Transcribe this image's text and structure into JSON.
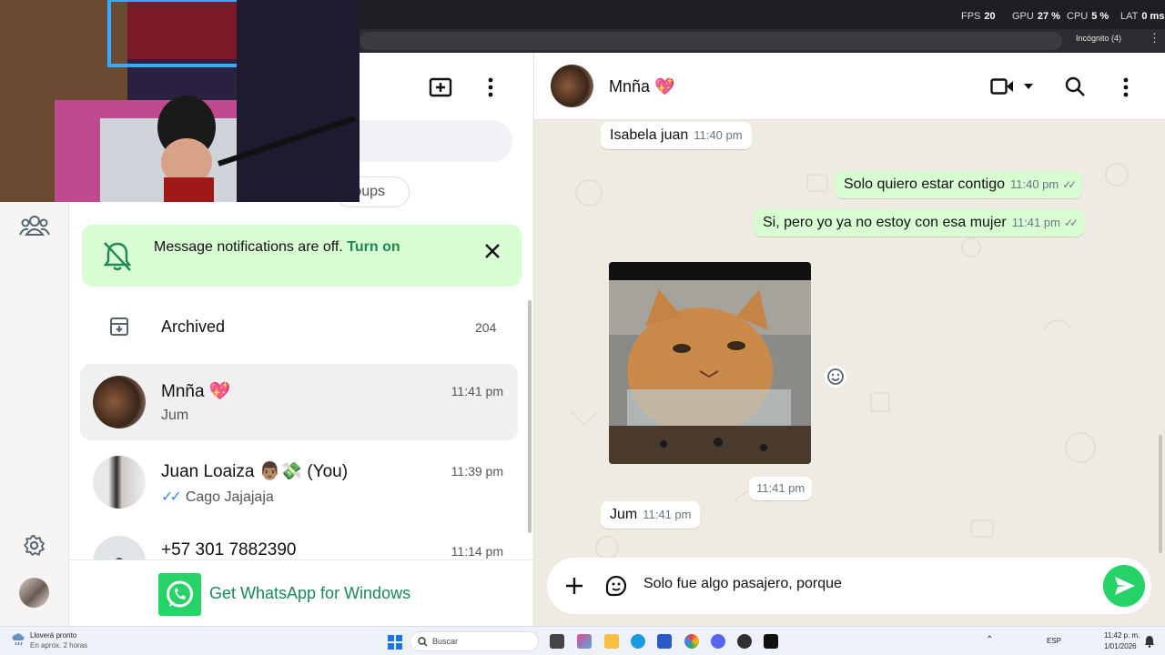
{
  "overlay": {
    "fps_label": "FPS",
    "fps_value": "20",
    "gpu_label": "GPU",
    "gpu_value": "27 %",
    "cpu_label": "CPU",
    "cpu_value": "5 %",
    "lat_label": "LAT",
    "lat_value": "0 ms"
  },
  "browser": {
    "incognito_label": "Incógnito (4)"
  },
  "chat_list": {
    "filter_chip": "roups",
    "notification": {
      "text": "Message notifications are off.",
      "link": "Turn on"
    },
    "archived": {
      "label": "Archived",
      "count": "204"
    },
    "chats": [
      {
        "name": "Mnña 💖",
        "time": "11:41 pm",
        "preview": "Jum",
        "selected": true
      },
      {
        "name": "Juan Loaiza 👨🏽💸 (You)",
        "time": "11:39 pm",
        "preview": "Cago Jajajaja",
        "ticks": "✓✓"
      },
      {
        "name": "+57 301 7882390",
        "time": "11:14 pm",
        "preview": ""
      }
    ],
    "get_app": "Get WhatsApp for Windows"
  },
  "conversation": {
    "contact_name": "Mnña 💖",
    "messages": [
      {
        "text": "Isabela juan",
        "time": "11:40 pm",
        "dir": "in"
      },
      {
        "text": "Solo quiero estar contigo",
        "time": "11:40 pm",
        "dir": "out"
      },
      {
        "text": "Si, pero yo ya no estoy con esa mujer",
        "time": "11:41 pm",
        "dir": "out"
      },
      {
        "text": "",
        "time": "11:41 pm",
        "dir": "in",
        "kind": "sticker"
      },
      {
        "text": "Jum",
        "time": "11:41 pm",
        "dir": "in"
      }
    ],
    "composer_text": "Solo fue algo pasajero, porque"
  },
  "taskbar": {
    "weather_title": "Lloverá pronto",
    "weather_sub": "En aprox. 2 horas",
    "search_placeholder": "Buscar",
    "lang": "ESP",
    "time": "11:42 p. m.",
    "date": "1/01/2026"
  },
  "colors": {
    "accent": "#25d366",
    "bubble_out": "#d9fdd3",
    "chat_bg": "#efeae2",
    "link_green": "#1b8755"
  }
}
